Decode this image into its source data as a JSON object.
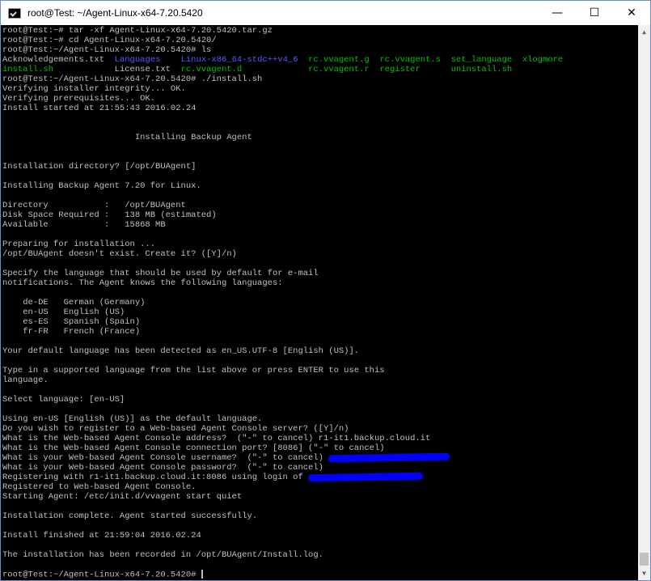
{
  "window": {
    "title": "root@Test: ~/Agent-Linux-x64-7.20.5420",
    "minimize_glyph": "—",
    "maximize_glyph": "☐",
    "close_glyph": "✕"
  },
  "terminal": {
    "lines": {
      "l01": "root@Test:~# tar -xf Agent-Linux-x64-7.20.5420.tar.gz",
      "l02": "root@Test:~# cd Agent-Linux-x64-7.20.5420/",
      "l03": "root@Test:~/Agent-Linux-x64-7.20.5420# ls",
      "l06": "root@Test:~/Agent-Linux-x64-7.20.5420# ./install.sh",
      "l07": "Verifying installer integrity... OK.",
      "l08": "Verifying prerequisites... OK.",
      "l09": "Install started at 21:55:43 2016.02.24",
      "l10": "",
      "l11": "",
      "l12": "                          Installing Backup Agent",
      "l13": "",
      "l14": "",
      "l15": "Installation directory? [/opt/BUAgent]",
      "l16": "",
      "l17": "Installing Backup Agent 7.20 for Linux.",
      "l18": "",
      "l19": "Directory           :   /opt/BUAgent",
      "l20": "Disk Space Required :   138 MB (estimated)",
      "l21": "Available           :   15868 MB",
      "l22": "",
      "l23": "Preparing for installation ...",
      "l24": "/opt/BUAgent doesn't exist. Create it? ([Y]/n)",
      "l25": "",
      "l26": "Specify the language that should be used by default for e-mail",
      "l27": "notifications. The Agent knows the following languages:",
      "l28": "",
      "l29": "    de-DE   German (Germany)",
      "l30": "    en-US   English (US)",
      "l31": "    es-ES   Spanish (Spain)",
      "l32": "    fr-FR   French (France)",
      "l33": "",
      "l34": "Your default language has been detected as en_US.UTF-8 [English (US)].",
      "l35": "",
      "l36": "Type in a supported language from the list above or press ENTER to use this",
      "l37": "language.",
      "l38": "",
      "l39": "Select language: [en-US]",
      "l40": "",
      "l41": "Using en-US [English (US)] as the default language.",
      "l42": "Do you wish to register to a Web-based Agent Console server? ([Y]/n)",
      "l43": "What is the Web-based Agent Console address?  (\"-\" to cancel) r1-it1.backup.cloud.it",
      "l44": "What is the Web-based Agent Console connection port? [8086] (\"-\" to cancel)",
      "l45": "What is your Web-based Agent Console username?  (\"-\" to cancel) ",
      "l46": "What is your Web-based Agent Console password?  (\"-\" to cancel)",
      "l47": "Registering with r1-it1.backup.cloud.it:8086 using login of ",
      "l48": "Registered to Web-based Agent Console.",
      "l49": "Starting Agent: /etc/init.d/vvagent start quiet",
      "l50": "",
      "l51": "Installation complete. Agent started successfully.",
      "l52": "",
      "l53": "Install finished at 21:59:04 2016.02.24",
      "l54": "",
      "l55": "The installation has been recorded in /opt/BUAgent/Install.log.",
      "l56": "",
      "l57": "root@Test:~/Agent-Linux-x64-7.20.5420# "
    },
    "ls_row1": {
      "c1": "Acknowledgements.txt",
      "c2": "Languages",
      "c3": "Linux-x86_64-stdc++v4_6",
      "c4": "rc.vvagent.g",
      "c5": "rc.vvagent.s",
      "c6": "set_language",
      "c7": "xlogmore"
    },
    "ls_row2": {
      "c1": "install.sh",
      "c2": "License.txt",
      "c3": "rc.vvagent.d",
      "c4": "rc.vvagent.r",
      "c5": "register",
      "c6": "uninstall.sh"
    },
    "colors": {
      "foreground": "#c0c0c0",
      "directory": "#5a5aff",
      "executable": "#00c000",
      "redaction": "#0000ff"
    }
  }
}
